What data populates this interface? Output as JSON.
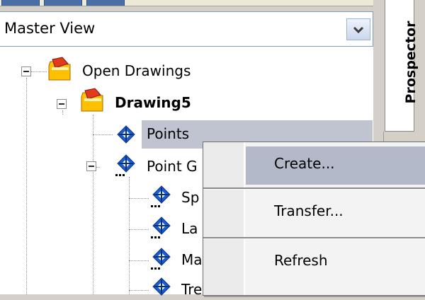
{
  "view_selector": {
    "value": "Master View"
  },
  "tree": {
    "open_drawings": "Open Drawings",
    "drawing": "Drawing5",
    "points": "Points",
    "point_groups_partial": "Point G",
    "children_partial": [
      "Sp",
      "La",
      "Ma",
      "Tre"
    ]
  },
  "side_panel": {
    "label": "Prospector"
  },
  "context_menu": {
    "items": [
      {
        "label": "Create..."
      },
      {
        "label": "Transfer..."
      },
      {
        "label": "Refresh"
      }
    ]
  },
  "icons": {
    "drawing_collection": "drawing-folder-icon",
    "point": "point-icon",
    "point_group": "point-group-icon"
  }
}
